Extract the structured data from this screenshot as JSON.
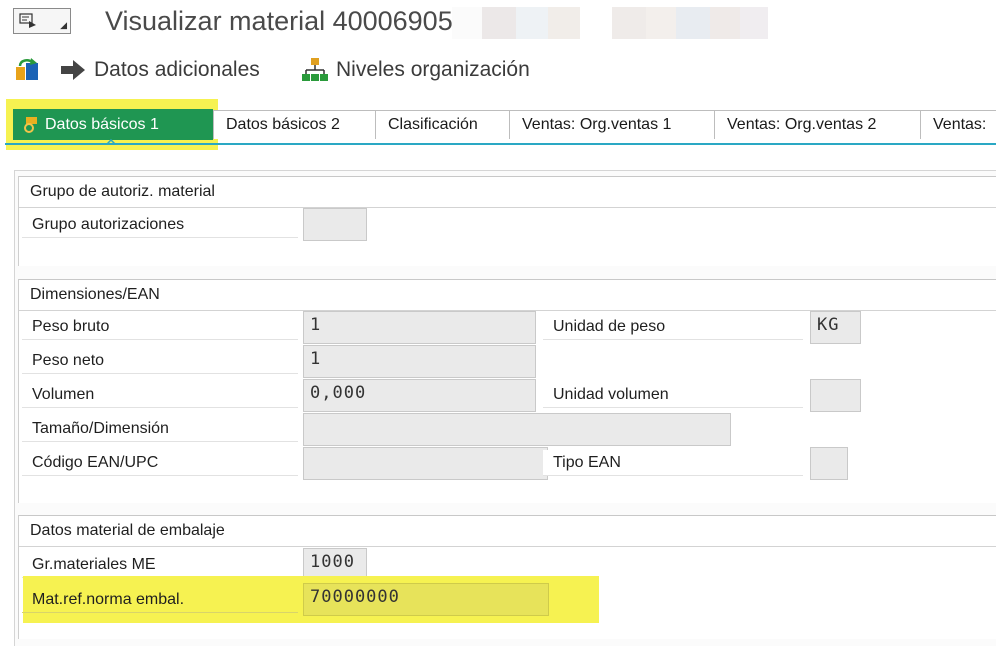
{
  "title": "Visualizar material 40006905",
  "toolbar": {
    "datos_adicionales": "Datos adicionales",
    "niveles_organizacion": "Niveles organización"
  },
  "tabs": [
    {
      "label": "Datos básicos 1",
      "active": true
    },
    {
      "label": "Datos básicos 2"
    },
    {
      "label": "Clasificación"
    },
    {
      "label": "Ventas: Org.ventas 1"
    },
    {
      "label": "Ventas: Org.ventas 2"
    },
    {
      "label": "Ventas:"
    }
  ],
  "groups": {
    "autorizacion": {
      "title": "Grupo de autoriz. material",
      "grupo_autorizaciones": {
        "label": "Grupo autorizaciones",
        "value": ""
      }
    },
    "dimensiones": {
      "title": "Dimensiones/EAN",
      "peso_bruto": {
        "label": "Peso bruto",
        "value": "1"
      },
      "unidad_peso": {
        "label": "Unidad de peso",
        "value": "KG"
      },
      "peso_neto": {
        "label": "Peso neto",
        "value": "1"
      },
      "volumen": {
        "label": "Volumen",
        "value": "0,000"
      },
      "unidad_volumen": {
        "label": "Unidad volumen",
        "value": ""
      },
      "tamano": {
        "label": "Tamaño/Dimensión",
        "value": ""
      },
      "ean": {
        "label": "Código EAN/UPC",
        "value": ""
      },
      "tipo_ean": {
        "label": "Tipo EAN",
        "value": ""
      }
    },
    "embalaje": {
      "title": "Datos material de embalaje",
      "gr_materiales": {
        "label": "Gr.materiales ME",
        "value": "1000"
      },
      "mat_ref": {
        "label": "Mat.ref.norma embal.",
        "value": "70000000"
      }
    }
  },
  "colors": {
    "active_tab": "#1f9652",
    "highlight": "#f6f251",
    "tab_underline": "#2aa8c4"
  },
  "icons": [
    "menu-icon",
    "transport-icon",
    "arrow-right-icon",
    "org-structure-icon",
    "pin-icon"
  ]
}
